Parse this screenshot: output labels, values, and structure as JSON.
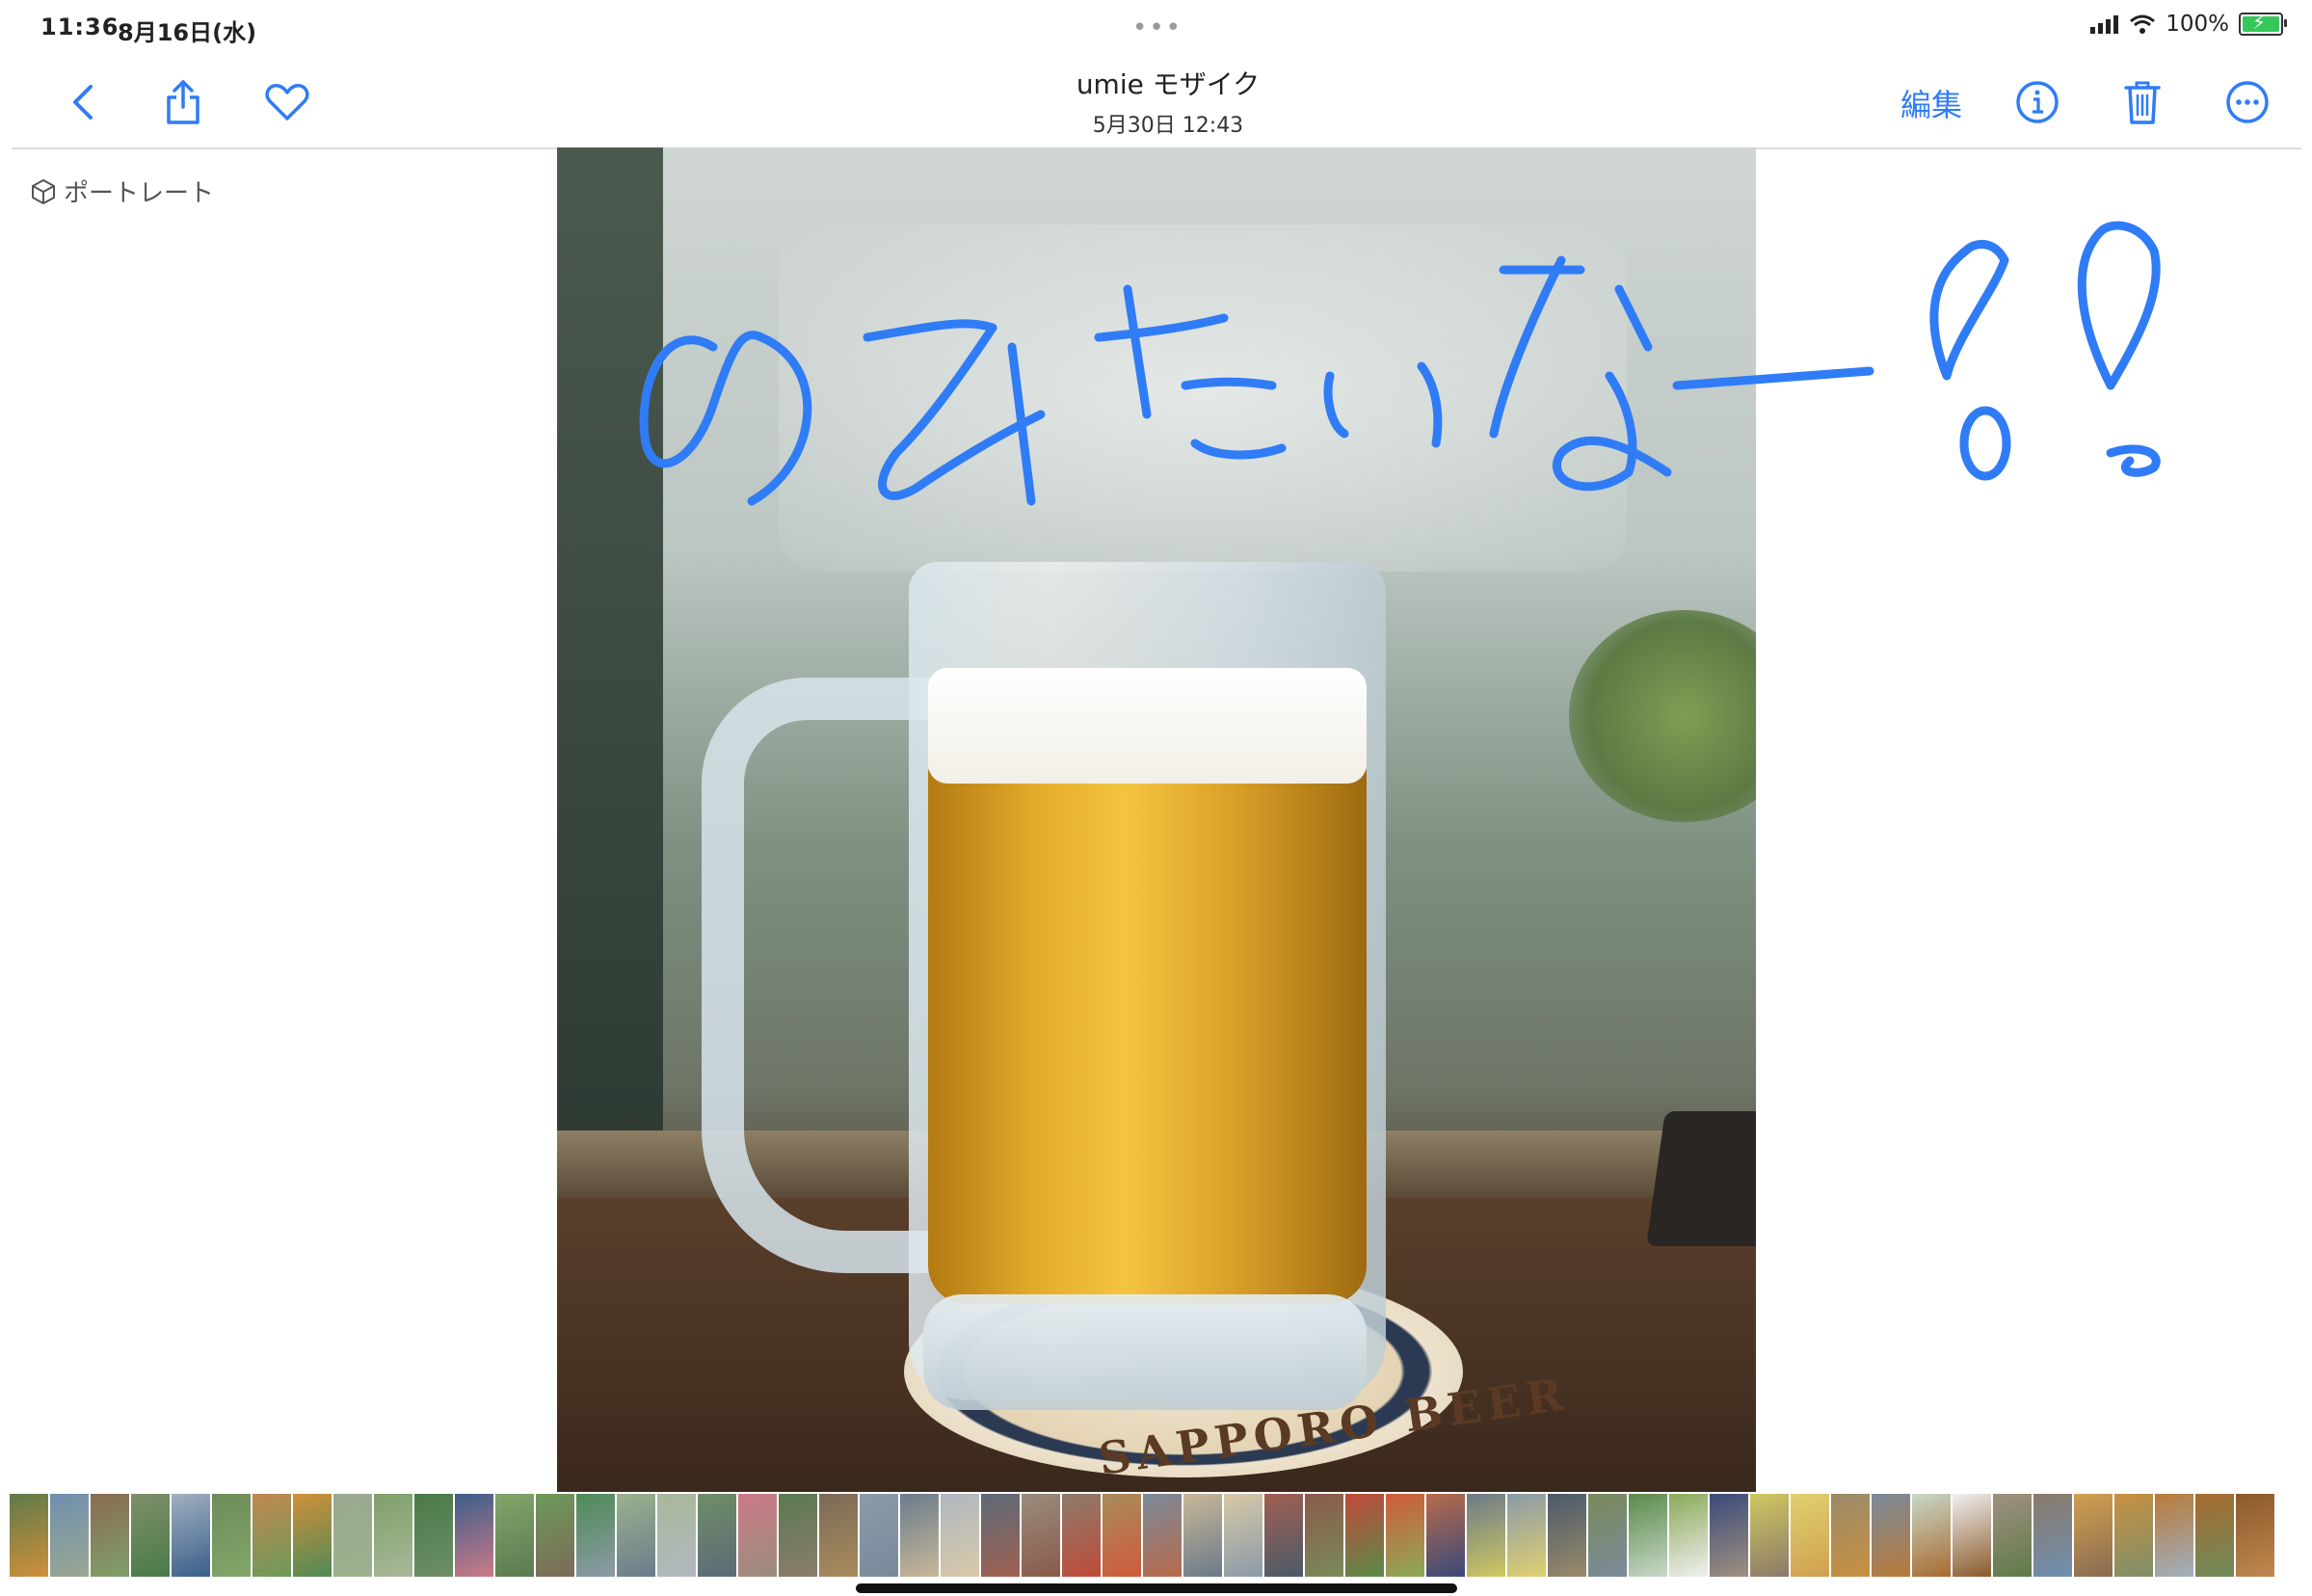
{
  "status_bar": {
    "time": "11:36",
    "date": "8月16日(水)",
    "battery_percent": "100%",
    "battery_level": 1.0,
    "charging": true,
    "signal": "cellular-bars-icon",
    "wifi": "wifi-icon"
  },
  "nav": {
    "title": "umie モザイク",
    "subtitle": "5月30日 12:43",
    "edit_label": "編集",
    "left_icons": [
      "chevron-left-icon",
      "share-icon",
      "heart-icon"
    ],
    "right_icons": [
      "info-icon",
      "trash-icon",
      "more-icon"
    ],
    "accent_color": "#2f7cf6"
  },
  "photo": {
    "badge_label": "ポートレート",
    "badge_icon": "cube-icon",
    "handwritten_text": "のみたいなー!!",
    "handwriting_color": "#2f7cf6",
    "coaster_text": "SAPPORO BEER"
  },
  "filmstrip": {
    "thumb_count": 56,
    "colors": [
      "#5e7a4a",
      "#6f8fb0",
      "#8a6a52",
      "#7e8f6a",
      "#a0b0c0",
      "#6d8c5a",
      "#c08850",
      "#d0903a",
      "#9aa890",
      "#7fa06a",
      "#4a7a4a",
      "#3b5e8a",
      "#82a66a",
      "#6c9a5a",
      "#4f8a56",
      "#9bb28c",
      "#a8b898",
      "#6e8e66",
      "#cc7a88",
      "#5a7a52",
      "#7c6a58",
      "#8c9aa8",
      "#6a7c8c",
      "#b0b8c0",
      "#5c6a78",
      "#9a8c7c",
      "#8c7c6a",
      "#a88c5c",
      "#7a8a9a",
      "#c8b898",
      "#d8c8a8",
      "#a06050",
      "#8a5a4a",
      "#c04a3a",
      "#d05a3a",
      "#b86a4a",
      "#6a7a8a",
      "#8a9aa8",
      "#4a5a6a",
      "#7a8a5a",
      "#5a8a4a",
      "#8aaa5a",
      "#3a4a7a",
      "#d0c860",
      "#e0d070",
      "#9a8a6a",
      "#7a8a9a",
      "#c8d8c8",
      "#f0f0f0",
      "#a09080",
      "#8a7a6a",
      "#d0a050",
      "#c89040",
      "#b87a38",
      "#a86a30",
      "#8a5a2a"
    ]
  }
}
